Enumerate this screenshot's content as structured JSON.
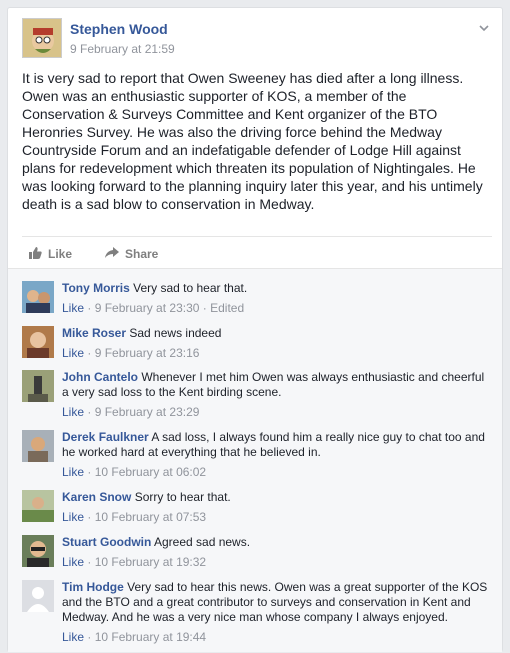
{
  "post": {
    "author": "Stephen Wood",
    "timestamp": "9 February at 21:59",
    "text": "It is very sad to report that Owen Sweeney has died after a long illness. Owen was an enthusiastic supporter of KOS, a member of the Conservation & Surveys Committee and Kent organizer of the BTO Heronries Survey. He was also the driving force behind the Medway Countryside Forum and an indefatigable defender of Lodge Hill against plans for redevelopment which threaten its population of Nightingales. He was looking forward to the planning inquiry later this year, and his untimely death is a sad blow to conservation in Medway."
  },
  "actions": {
    "like": "Like",
    "share": "Share"
  },
  "comments": [
    {
      "name": "Tony Morris",
      "text": "Very sad to hear that.",
      "like": "Like",
      "time": "9 February at 23:30",
      "edited": "Edited"
    },
    {
      "name": "Mike Roser",
      "text": "Sad news indeed",
      "like": "Like",
      "time": "9 February at 23:16"
    },
    {
      "name": "John Cantelo",
      "text": "Whenever I met him Owen was always enthusiastic and cheerful a very sad loss to the Kent birding scene.",
      "like": "Like",
      "time": "9 February at 23:29"
    },
    {
      "name": "Derek Faulkner",
      "text": "A sad loss, I always found him a really nice guy to chat too and he worked hard at everything that he believed in.",
      "like": "Like",
      "time": "10 February at 06:02"
    },
    {
      "name": "Karen Snow",
      "text": "Sorry to hear that.",
      "like": "Like",
      "time": "10 February at 07:53"
    },
    {
      "name": "Stuart Goodwin",
      "text": "Agreed sad news.",
      "like": "Like",
      "time": "10 February at 19:32"
    },
    {
      "name": "Tim Hodge",
      "text": "Very sad to hear this news. Owen was a great supporter of the KOS and the BTO and a great contributor to surveys and conservation in Kent and Medway. And he was a very nice man whose company I always enjoyed.",
      "like": "Like",
      "time": "10 February at 19:44"
    }
  ],
  "icons": {
    "like": "thumbs-up-icon",
    "share": "share-arrow-icon",
    "menu": "chevron-down-icon"
  }
}
